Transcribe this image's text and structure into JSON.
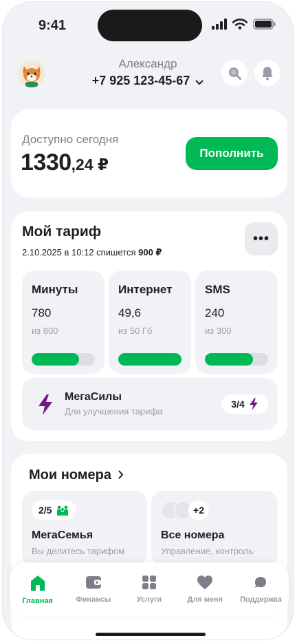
{
  "status_bar": {
    "time": "9:41"
  },
  "header": {
    "user_name": "Александр",
    "phone": "+7 925 123-45-67"
  },
  "balance": {
    "label": "Доступно сегодня",
    "amount_whole": "1330",
    "amount_fraction": ",24 ₽",
    "topup_label": "Пополнить"
  },
  "tariff": {
    "title": "Мой тариф",
    "charge_prefix": "2.10.2025 в 10:12 спишется",
    "charge_amount": "900 ₽",
    "more_label": "•••",
    "tiles": [
      {
        "label": "Минуты",
        "value": "780",
        "limit": "из 800",
        "progress": 0.75
      },
      {
        "label": "Интернет",
        "value": "49,6",
        "limit": "из 50 Гб",
        "progress": 1.0
      },
      {
        "label": "SMS",
        "value": "240",
        "limit": "из 300",
        "progress": 0.76
      }
    ],
    "megasily": {
      "title": "МегаСилы",
      "subtitle": "Для улучшения тарифа",
      "badge": "3/4"
    }
  },
  "numbers": {
    "title": "Мои номера",
    "family": {
      "badge": "2/5",
      "title": "МегаСемья",
      "subtitle": "Вы делитесь тарифом"
    },
    "all": {
      "badge": "+2",
      "title": "Все номера",
      "subtitle": "Управление, контроль"
    }
  },
  "bottom_nav": [
    {
      "label": "Главная",
      "icon": "home-icon",
      "active": true
    },
    {
      "label": "Финансы",
      "icon": "wallet-icon",
      "active": false
    },
    {
      "label": "Услуги",
      "icon": "grid-icon",
      "active": false
    },
    {
      "label": "Для меня",
      "icon": "heart-icon",
      "active": false
    },
    {
      "label": "Поддержка",
      "icon": "chat-icon",
      "active": false
    }
  ],
  "colors": {
    "accent": "#00b956",
    "megasily": "#731982",
    "background": "#f1f2f6"
  }
}
